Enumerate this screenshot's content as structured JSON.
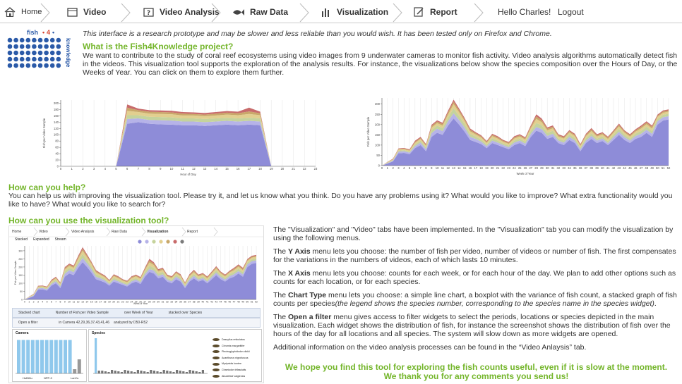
{
  "nav": {
    "tabs": [
      {
        "label": "Home",
        "icon": "home-icon"
      },
      {
        "label": "Video",
        "icon": "video-icon"
      },
      {
        "label": "Video Analysis",
        "icon": "question-icon"
      },
      {
        "label": "Raw Data",
        "icon": "fish-icon"
      },
      {
        "label": "Visualization",
        "icon": "bar-chart-icon"
      },
      {
        "label": "Report",
        "icon": "report-icon"
      }
    ],
    "greeting": "Hello Charles!",
    "logout": "Logout"
  },
  "intro": {
    "notice": "This interface is a research prototype and may be slower and less reliable than you would wish. It has been tested only on Firefox and Chrome.",
    "title": "What is the Fish4Knowledge project?",
    "text": "We want to contribute to the study of coral reef ecosystems using video images from 9 underwater cameras to monitor fish activity. Video analysis algorithms automatically detect fish in the videos. This visualization tool supports the exploration of the analysis results.  For instance, the visualizations below show the species composition over the Hours of Day, or the Weeks of Year. You can click on them to explore them further.",
    "logo_text": "fish 4 knowledge"
  },
  "help": {
    "title": "How can you help?",
    "text": "You can help us with improving the visualization tool. Please try it, and let us know what you think. Do you have any problems using it? What would you like to improve? What extra functionality would you like to have? What would you like to search for?"
  },
  "use": {
    "title": "How can you use the visualization tool?",
    "p1": "The \"Visualization\" and \"Video\" tabs have been implemented. In the \"Visualization\" tab you can modify the visualization by using the following menus.",
    "p2_b": "Y Axis",
    "p2_pre": "The ",
    "p2": " menu lets you choose: the number of fish per video, number of videos or number of fish. The first compensates for the variations in the numbers of videos, each of which lasts 10 minutes.",
    "p3_b": "X Axis",
    "p3": " menu lets you choose: counts for each week, or for each hour of the day. We plan to add other options such as counts for each location, or for each species.",
    "p4_b": "Chart Type",
    "p4": " menu lets you choose: a simple line chart, a boxplot with the variance of fish count, a stacked graph of fish counts per species",
    "p4_i": "(the legend shows the species number, corresponding to the species name in the species widget)",
    "p4_end": ".",
    "p5_b": "Open a filter",
    "p5": " menu gives access to filter widgets to select the periods, locations or species depicted in the main visualization. Each widget shows the distribution of fish, for instance the screenshot shows the distribution of fish over the hours of the day for all locations and all species. The system will slow down as more widgets are opened.",
    "p6": "Additional information on the video analysis processes can be found in the “Video Anlaysis” tab.",
    "closing1": "We hope you find this tool for exploring the fish counts useful, even if it is slow at the moment.",
    "closing2": "We thank you for any comments you send us!"
  },
  "mini": {
    "tabs": [
      "Home",
      "Video",
      "Video Analysis",
      "Raw Data",
      "Visualization",
      "Report"
    ],
    "legend": [
      "Stacked",
      "Expanded",
      "Stream"
    ],
    "toolbar": [
      "Stacked chart",
      "Number of Fish per Video Sample",
      "over Week of Year",
      "stacked over Species"
    ],
    "filter": "Open a filter",
    "filter_info": "in Camera 42,29,36,37,43,41,46",
    "filter_info2": "analyzed by D50-R52",
    "camera_title": "Camera",
    "species_title": "Species",
    "camera_labels": [
      "HoBiHu",
      "NPP-3",
      "LanYu"
    ],
    "species_names": [
      "Dascyllus reticulatus",
      "Chromis margaritifer",
      "Plectroglyphidodon dickii",
      "Acanthurus nigrofuscus",
      "Myripristis kuntee",
      "Chaetodon trifascialis",
      "Abudefduf vaigiensis"
    ]
  },
  "chart_data": [
    {
      "type": "area",
      "xlabel": "Hour of Day",
      "ylabel": "Fish per Video Sample",
      "x": [
        0,
        1,
        2,
        3,
        4,
        5,
        6,
        7,
        8,
        9,
        10,
        11,
        12,
        13,
        14,
        15,
        16,
        17,
        18,
        19,
        20,
        21,
        22,
        23
      ],
      "ylim": [
        0,
        210
      ],
      "yticks": [
        0,
        20,
        40,
        60,
        80,
        100,
        120,
        140,
        160,
        180,
        200
      ],
      "series_colors": [
        "#8e8cd8",
        "#b6b3e8",
        "#c5d39c",
        "#e2cf8f",
        "#c9a86a",
        "#c86b6b"
      ],
      "series": [
        {
          "values": [
            0,
            0,
            0,
            0,
            0,
            0,
            135,
            140,
            135,
            133,
            132,
            130,
            130,
            128,
            130,
            132,
            130,
            132,
            130,
            0,
            0,
            0,
            0,
            0
          ]
        },
        {
          "values": [
            0,
            0,
            0,
            0,
            0,
            0,
            15,
            12,
            12,
            13,
            13,
            12,
            12,
            12,
            12,
            12,
            12,
            12,
            12,
            0,
            0,
            0,
            0,
            0
          ]
        },
        {
          "values": [
            0,
            0,
            0,
            0,
            0,
            0,
            12,
            10,
            10,
            10,
            10,
            10,
            10,
            10,
            10,
            10,
            10,
            10,
            10,
            0,
            0,
            0,
            0,
            0
          ]
        },
        {
          "values": [
            0,
            0,
            0,
            0,
            0,
            0,
            14,
            10,
            10,
            10,
            10,
            9,
            9,
            9,
            9,
            10,
            10,
            12,
            10,
            0,
            0,
            0,
            0,
            0
          ]
        },
        {
          "values": [
            0,
            0,
            0,
            0,
            0,
            0,
            10,
            6,
            6,
            6,
            6,
            6,
            5,
            5,
            6,
            6,
            6,
            8,
            6,
            0,
            0,
            0,
            0,
            0
          ]
        },
        {
          "values": [
            0,
            0,
            0,
            0,
            0,
            0,
            10,
            5,
            5,
            5,
            5,
            5,
            5,
            5,
            5,
            5,
            5,
            12,
            5,
            0,
            0,
            0,
            0,
            0
          ]
        }
      ]
    },
    {
      "type": "area",
      "xlabel": "Week of Year",
      "ylabel": "Fish per Video Sample",
      "x": [
        0,
        1,
        2,
        3,
        4,
        5,
        6,
        7,
        8,
        9,
        10,
        11,
        12,
        13,
        14,
        15,
        16,
        17,
        18,
        19,
        20,
        21,
        22,
        23,
        24,
        25,
        26,
        27,
        28,
        29,
        30,
        31,
        32,
        33,
        34,
        35,
        36,
        37,
        38,
        39,
        40,
        41,
        42,
        43,
        44,
        45,
        46,
        47,
        48,
        49,
        50,
        51,
        52
      ],
      "ylim": [
        0,
        330
      ],
      "yticks": [
        0,
        50,
        100,
        150,
        200,
        250,
        300
      ],
      "series_colors": [
        "#8e8cd8",
        "#b6b3e8",
        "#c5d39c",
        "#e2cf8f",
        "#c9a86a",
        "#c86b6b"
      ],
      "series": [
        {
          "values": [
            0,
            10,
            20,
            60,
            62,
            55,
            85,
            100,
            70,
            140,
            160,
            150,
            195,
            230,
            200,
            165,
            125,
            115,
            105,
            85,
            110,
            100,
            90,
            80,
            100,
            110,
            95,
            140,
            170,
            160,
            130,
            140,
            110,
            100,
            125,
            110,
            70,
            110,
            130,
            110,
            120,
            100,
            125,
            150,
            125,
            110,
            130,
            140,
            160,
            140,
            200,
            220,
            225
          ]
        },
        {
          "values": [
            0,
            2,
            4,
            8,
            8,
            8,
            10,
            12,
            10,
            18,
            20,
            18,
            22,
            25,
            22,
            20,
            15,
            15,
            12,
            10,
            12,
            12,
            10,
            10,
            12,
            12,
            12,
            15,
            18,
            18,
            15,
            15,
            12,
            12,
            15,
            12,
            10,
            12,
            15,
            12,
            12,
            10,
            14,
            15,
            14,
            12,
            14,
            15,
            15,
            15,
            16,
            16,
            16
          ]
        },
        {
          "values": [
            0,
            2,
            3,
            5,
            5,
            5,
            8,
            10,
            8,
            15,
            15,
            15,
            18,
            25,
            20,
            18,
            15,
            12,
            10,
            8,
            12,
            10,
            8,
            8,
            10,
            10,
            10,
            15,
            20,
            18,
            15,
            15,
            10,
            10,
            12,
            12,
            8,
            12,
            12,
            10,
            10,
            10,
            12,
            14,
            12,
            10,
            12,
            14,
            15,
            14,
            12,
            12,
            12
          ]
        },
        {
          "values": [
            0,
            2,
            3,
            5,
            5,
            5,
            8,
            8,
            8,
            12,
            12,
            12,
            15,
            20,
            18,
            15,
            12,
            10,
            10,
            8,
            10,
            10,
            8,
            8,
            10,
            10,
            10,
            12,
            20,
            15,
            12,
            12,
            10,
            10,
            10,
            10,
            8,
            10,
            12,
            10,
            10,
            10,
            10,
            12,
            10,
            10,
            10,
            12,
            12,
            12,
            10,
            10,
            10
          ]
        },
        {
          "values": [
            0,
            1,
            2,
            3,
            3,
            3,
            5,
            5,
            5,
            8,
            8,
            8,
            10,
            12,
            10,
            8,
            8,
            6,
            6,
            5,
            6,
            6,
            5,
            5,
            6,
            6,
            6,
            8,
            12,
            10,
            8,
            8,
            6,
            6,
            6,
            6,
            5,
            6,
            8,
            6,
            6,
            6,
            6,
            8,
            6,
            6,
            6,
            8,
            8,
            8,
            6,
            6,
            6
          ]
        },
        {
          "values": [
            0,
            1,
            2,
            3,
            3,
            3,
            5,
            5,
            4,
            6,
            6,
            6,
            8,
            10,
            8,
            6,
            6,
            5,
            5,
            4,
            5,
            5,
            4,
            4,
            5,
            5,
            5,
            6,
            10,
            8,
            6,
            6,
            5,
            5,
            5,
            5,
            4,
            5,
            6,
            5,
            5,
            5,
            5,
            6,
            5,
            5,
            5,
            6,
            6,
            6,
            5,
            5,
            5
          ]
        }
      ]
    }
  ]
}
